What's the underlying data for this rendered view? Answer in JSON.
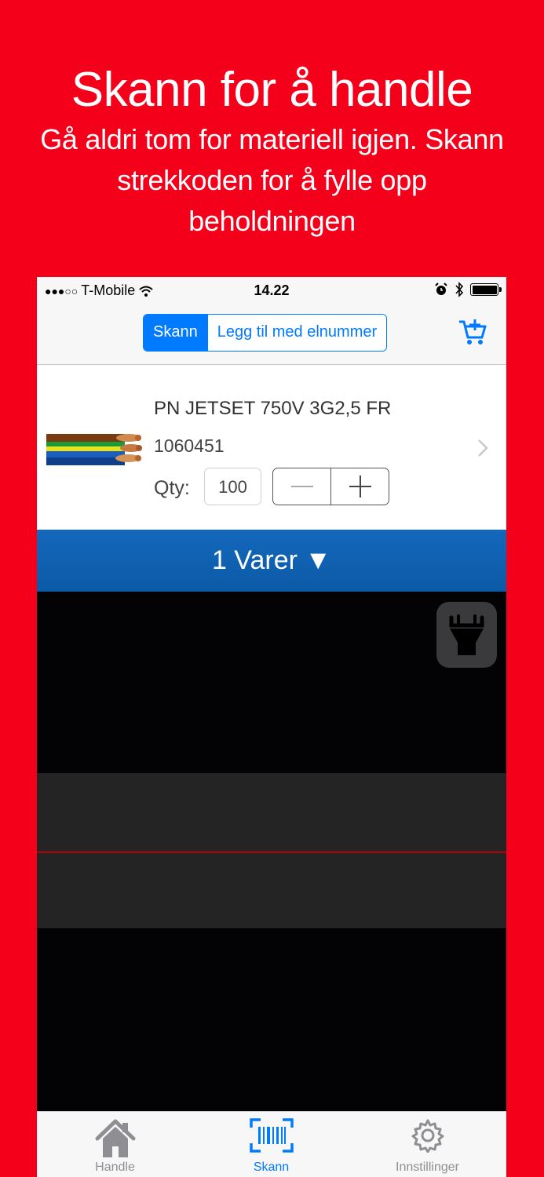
{
  "promo": {
    "title": "Skann for å handle",
    "subtitle": "Gå aldri tom for materiell igjen. Skann strekkoden for å fylle opp beholdningen"
  },
  "status_bar": {
    "carrier": "T-Mobile",
    "signal_dots": "●●●○○",
    "time": "14.22"
  },
  "nav": {
    "segments": [
      {
        "label": "Skann",
        "active": true
      },
      {
        "label": "Legg til med elnummer",
        "active": false
      }
    ],
    "cart_icon": "add-to-cart-icon"
  },
  "product": {
    "name": "PN JETSET 750V 3G2,5 FR",
    "number": "1060451",
    "qty_label": "Qty:",
    "qty_value": "100"
  },
  "items_bar": {
    "label": "1 Varer ▼"
  },
  "tabs": [
    {
      "label": "Handle",
      "icon": "house-icon",
      "active": false
    },
    {
      "label": "Skann",
      "icon": "barcode-scan-icon",
      "active": true
    },
    {
      "label": "Innstillinger",
      "icon": "gear-icon",
      "active": false
    }
  ],
  "colors": {
    "background": "#f4001b",
    "accent": "#007aff",
    "items_bar": "#0b5aa7",
    "scan_line": "#b3000a"
  }
}
